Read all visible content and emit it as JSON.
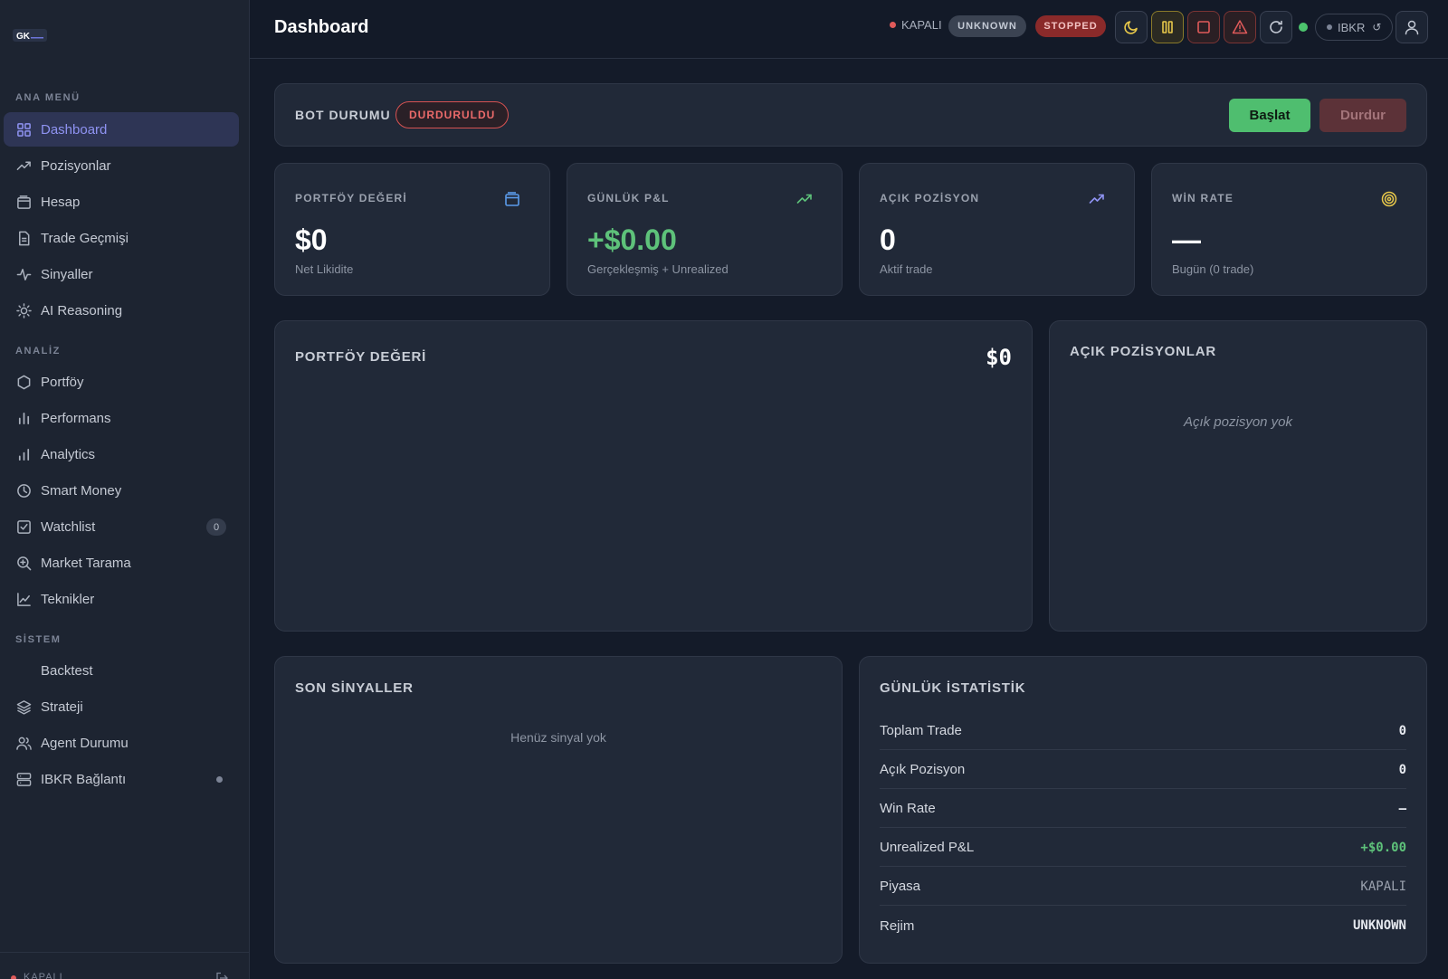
{
  "sidebar": {
    "logo_text": "GK",
    "sections": [
      {
        "label": "ANA MENÜ"
      },
      {
        "label": "ANALİZ"
      },
      {
        "label": "SİSTEM"
      }
    ],
    "items": [
      {
        "label": "Dashboard",
        "icon": "grid-icon"
      },
      {
        "label": "Pozisyonlar",
        "icon": "trending-up-icon"
      },
      {
        "label": "Hesap",
        "icon": "wallet-icon"
      },
      {
        "label": "Trade Geçmişi",
        "icon": "document-icon"
      },
      {
        "label": "Sinyaller",
        "icon": "activity-icon"
      },
      {
        "label": "AI Reasoning",
        "icon": "sun-icon"
      },
      {
        "label": "Portföy",
        "icon": "hexagon-icon"
      },
      {
        "label": "Performans",
        "icon": "bar-chart-icon"
      },
      {
        "label": "Analytics",
        "icon": "bar-chart-alt-icon"
      },
      {
        "label": "Smart Money",
        "icon": "clock-icon"
      },
      {
        "label": "Watchlist",
        "icon": "checkbox-icon",
        "badge": "0"
      },
      {
        "label": "Market Tarama",
        "icon": "zoom-icon"
      },
      {
        "label": "Teknikler",
        "icon": "line-chart-icon"
      },
      {
        "label": "Backtest",
        "icon": ""
      },
      {
        "label": "Strateji",
        "icon": "layers-icon"
      },
      {
        "label": "Agent Durumu",
        "icon": "users-icon"
      },
      {
        "label": "IBKR Bağlantı",
        "icon": "server-icon"
      }
    ],
    "footer_status": "KAPALI"
  },
  "header": {
    "title": "Dashboard",
    "market_status": "KAPALI",
    "regime_pill": "UNKNOWN",
    "bot_pill": "STOPPED",
    "broker_label": "IBKR",
    "broker_refresh": "↺"
  },
  "bot": {
    "label": "BOT DURUMU",
    "status": "DURDURULDU",
    "start_label": "Başlat",
    "stop_label": "Durdur"
  },
  "stats": [
    {
      "label": "PORTFÖY DEĞERİ",
      "value": "$0",
      "sub": "Net Likidite",
      "icon": "wallet-icon"
    },
    {
      "label": "GÜNLÜK P&L",
      "value": "+$0.00",
      "sub": "Gerçekleşmiş + Unrealized",
      "icon": "trending-up-icon"
    },
    {
      "label": "AÇIK POZİSYON",
      "value": "0",
      "sub": "Aktif trade",
      "icon": "trending-up-icon"
    },
    {
      "label": "WİN RATE",
      "value": "—",
      "sub": "Bugün (0 trade)",
      "icon": "target-icon"
    }
  ],
  "portfolio_panel": {
    "title": "PORTFÖY DEĞERİ",
    "value": "$0"
  },
  "positions_panel": {
    "title": "AÇIK POZİSYONLAR",
    "empty": "Açık pozisyon yok"
  },
  "signals_panel": {
    "title": "SON SİNYALLER",
    "empty": "Henüz sinyal yok"
  },
  "daily_panel": {
    "title": "GÜNLÜK İSTATİSTİK",
    "rows": [
      {
        "label": "Toplam Trade",
        "value": "0"
      },
      {
        "label": "Açık Pozisyon",
        "value": "0"
      },
      {
        "label": "Win Rate",
        "value": "—"
      },
      {
        "label": "Unrealized P&L",
        "value": "+$0.00"
      },
      {
        "label": "Piyasa",
        "value": "KAPALI"
      },
      {
        "label": "Rejim",
        "value": "UNKNOWN"
      }
    ]
  },
  "colors": {
    "accent": "#8f93f2",
    "positive": "#5ec27a",
    "negative": "#e05a5a",
    "warning": "#e8c84a"
  }
}
